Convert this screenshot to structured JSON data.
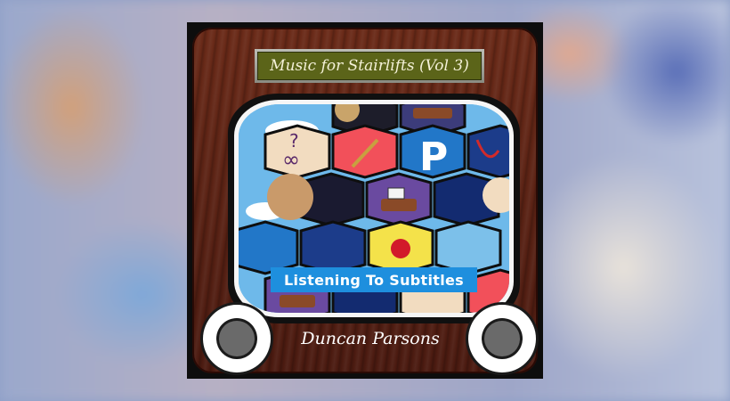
{
  "album": {
    "title": "Music for Stairlifts (Vol 3)",
    "screen_subtitle": "Listening To Subtitles",
    "artist": "Duncan Parsons"
  },
  "colors": {
    "wood": "#5a2214",
    "plate": "#5b6419",
    "subtitle_bar": "#1e8fde",
    "knob_center": "#6a6a6a"
  },
  "icons": {
    "tile_letter": "P",
    "infinity_symbol": "∞",
    "question_symbol": "?",
    "book_label": "Ticket"
  }
}
